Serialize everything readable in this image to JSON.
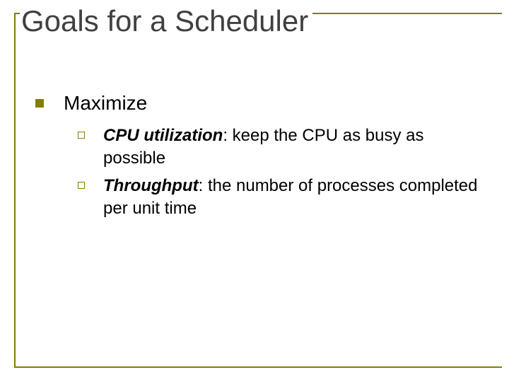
{
  "slide": {
    "title": "Goals for a Scheduler",
    "level1": {
      "text": "Maximize"
    },
    "items": [
      {
        "term": "CPU utilization",
        "desc": ":  keep the CPU as busy as possible"
      },
      {
        "term": "Throughput",
        "desc": ":  the number of processes completed per unit time"
      }
    ]
  }
}
